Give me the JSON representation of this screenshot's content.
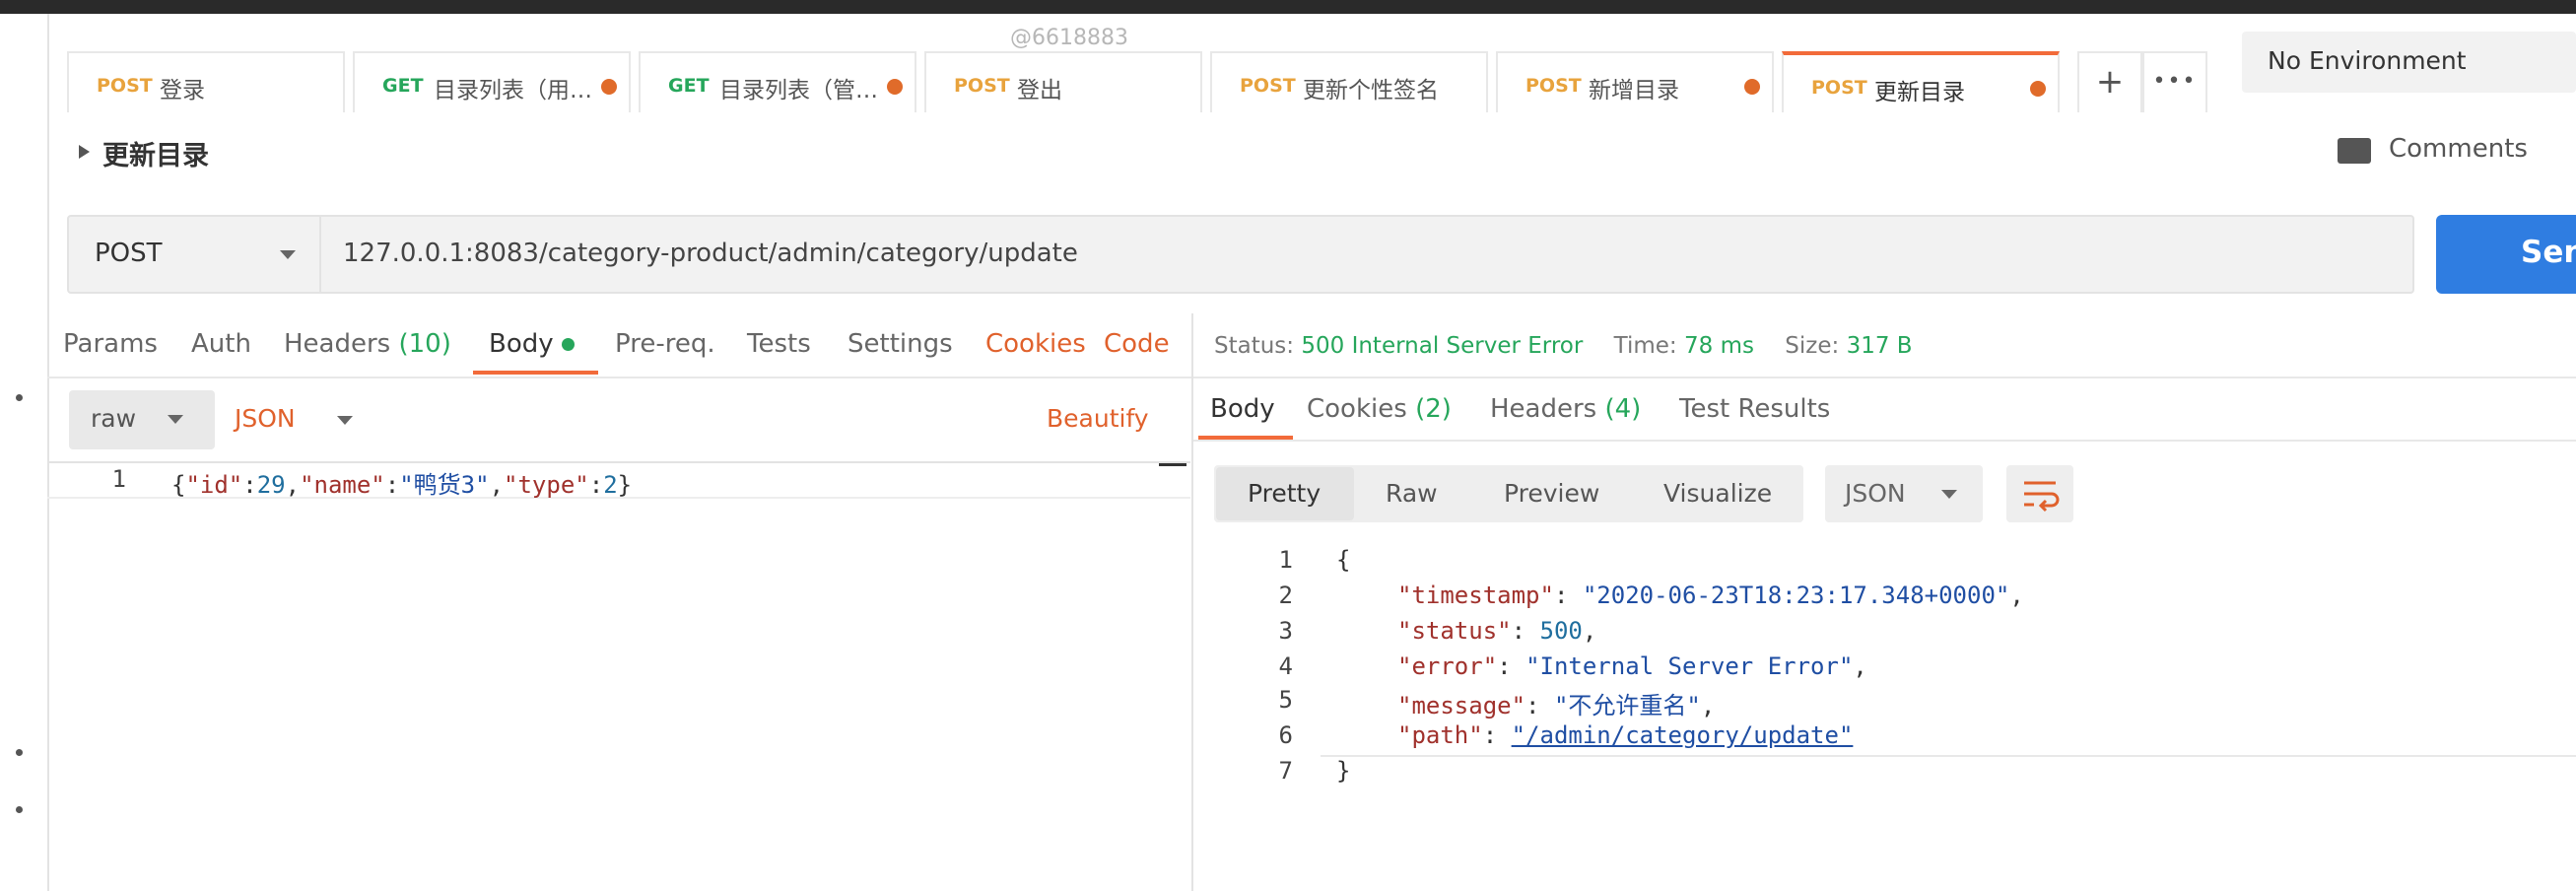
{
  "watermark": "@6618883",
  "tabs": [
    {
      "method": "POST",
      "name": "登录",
      "dot": false
    },
    {
      "method": "GET",
      "name": "目录列表（用…",
      "dot": true
    },
    {
      "method": "GET",
      "name": "目录列表（管…",
      "dot": true
    },
    {
      "method": "POST",
      "name": "登出",
      "dot": false
    },
    {
      "method": "POST",
      "name": "更新个性签名",
      "dot": false
    },
    {
      "method": "POST",
      "name": "新增目录",
      "dot": true
    },
    {
      "method": "POST",
      "name": "更新目录",
      "dot": true,
      "active": true
    }
  ],
  "tab_actions": {
    "add": "+",
    "more": "•••"
  },
  "environment": {
    "selected": "No Environment"
  },
  "request": {
    "title": "更新目录",
    "comments_label": "Comments",
    "method": "POST",
    "url": "127.0.0.1:8083/category-product/admin/category/update",
    "send_label": "Send"
  },
  "request_tabs": {
    "params": "Params",
    "auth": "Auth",
    "headers": "Headers",
    "headers_count": "(10)",
    "body": "Body",
    "prereq": "Pre-req.",
    "tests": "Tests",
    "settings": "Settings",
    "cookies": "Cookies",
    "code": "Code"
  },
  "body_editor": {
    "mode": "raw",
    "language": "JSON",
    "beautify": "Beautify",
    "line_number": "1",
    "content_parts": {
      "p1": "{",
      "k1": "\"id\"",
      "c1": ":",
      "v1": "29",
      "c2": ",",
      "k2": "\"name\"",
      "c3": ":",
      "v2": "\"鸭货3\"",
      "c4": ",",
      "k3": "\"type\"",
      "c5": ":",
      "v3": "2",
      "p2": "}"
    }
  },
  "response": {
    "status_label": "Status:",
    "status_value": "500 Internal Server Error",
    "time_label": "Time:",
    "time_value": "78 ms",
    "size_label": "Size:",
    "size_value": "317 B",
    "tabs": {
      "body": "Body",
      "cookies": "Cookies",
      "cookies_count": "(2)",
      "headers": "Headers",
      "headers_count": "(4)",
      "test_results": "Test Results"
    },
    "view_modes": [
      "Pretty",
      "Raw",
      "Preview",
      "Visualize"
    ],
    "format": "JSON",
    "lines": [
      {
        "no": "1",
        "text": "{"
      },
      {
        "no": "2",
        "key": "\"timestamp\"",
        "value": "\"2020-06-23T18:23:17.348+0000\"",
        "tail": ","
      },
      {
        "no": "3",
        "key": "\"status\"",
        "value": "500",
        "tail": ","
      },
      {
        "no": "4",
        "key": "\"error\"",
        "value": "\"Internal Server Error\"",
        "tail": ","
      },
      {
        "no": "5",
        "key": "\"message\"",
        "value": "\"不允许重名\"",
        "tail": ","
      },
      {
        "no": "6",
        "key": "\"path\"",
        "value": "\"/admin/category/update\"",
        "tail": ""
      },
      {
        "no": "7",
        "text": "}"
      }
    ]
  },
  "colors": {
    "accent_orange": "#f26b3a",
    "send_blue": "#2f7de1",
    "status_green": "#26a65b",
    "post": "#e8a33d",
    "get": "#26a65b"
  }
}
